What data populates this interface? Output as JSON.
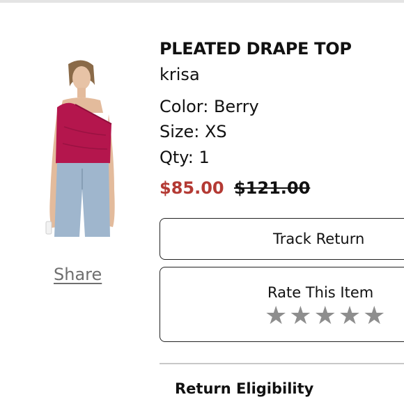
{
  "product": {
    "name": "PLEATED DRAPE TOP",
    "brand": "krisa",
    "color_text": "Color: Berry",
    "size_text": "Size: XS",
    "qty_text": "Qty: 1",
    "sale_price": "$85.00",
    "original_price": "$121.00",
    "image_alt": "model wearing berry one-shoulder top"
  },
  "actions": {
    "share_label": "Share",
    "track_return_label": "Track Return",
    "rate_label": "Rate This Item",
    "rating": 0,
    "max_rating": 5
  },
  "sections": {
    "return_eligibility_label": "Return Eligibility"
  },
  "colors": {
    "sale_price": "#b43a34",
    "star": "#8e8e8e",
    "top_color": "#b4164d",
    "jeans": "#9fb6cd"
  },
  "icons": {
    "star": "star-icon"
  }
}
